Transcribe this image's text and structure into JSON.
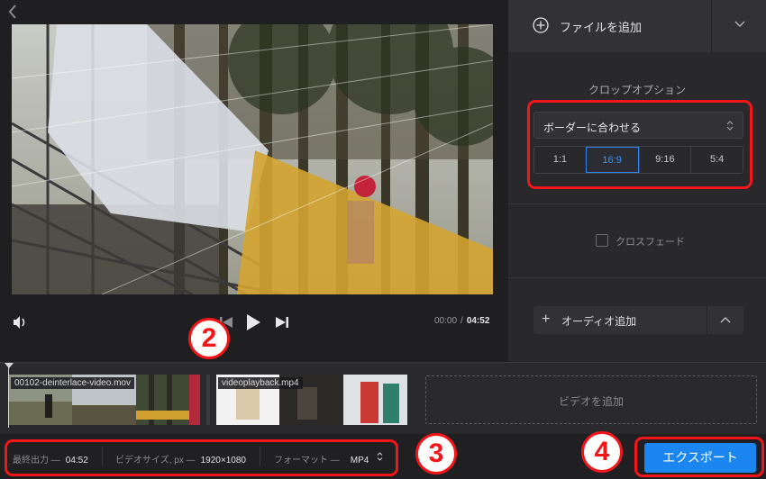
{
  "nav": {
    "back_icon": "chevron-left-icon"
  },
  "player": {
    "controls": {
      "volume_icon": "volume-icon",
      "prev_icon": "skip-previous-icon",
      "play_icon": "play-icon",
      "next_icon": "skip-next-icon"
    },
    "time": {
      "current": "00:00",
      "separator": "/",
      "total": "04:52"
    }
  },
  "right_panel": {
    "add_file": {
      "icon": "plus-circle-icon",
      "label": "ファイルを追加",
      "dropdown_icon": "chevron-down-icon"
    },
    "crop": {
      "title": "クロップオプション",
      "select_value": "ボーダーに合わせる",
      "ratios": [
        "1:1",
        "16:9",
        "9:16",
        "5:4"
      ],
      "active_ratio": "16:9"
    },
    "crossfade": {
      "label": "クロスフェード",
      "checked": false
    },
    "audio": {
      "label": "オーディオ追加",
      "icon": "plus-icon",
      "expand_icon": "chevron-up-icon"
    }
  },
  "timeline": {
    "clips": [
      {
        "name": "00102-deinterlace-video.mov"
      },
      {
        "name": "videoplayback.mp4"
      }
    ],
    "add_video_label": "ビデオを追加"
  },
  "bottom_bar": {
    "final_output_label": "最終出力 —",
    "final_output_value": "04:52",
    "video_size_label": "ビデオサイズ, px —",
    "video_size_value": "1920×1080",
    "format_label": "フォーマット —",
    "format_value": "MP4",
    "export_label": "エクスポート"
  },
  "annotations": {
    "badge_2": "2",
    "badge_3": "3",
    "badge_4": "4",
    "color": "#f2161a"
  },
  "colors": {
    "accent": "#1b86f0",
    "active_ratio_text": "#3d95ff"
  }
}
